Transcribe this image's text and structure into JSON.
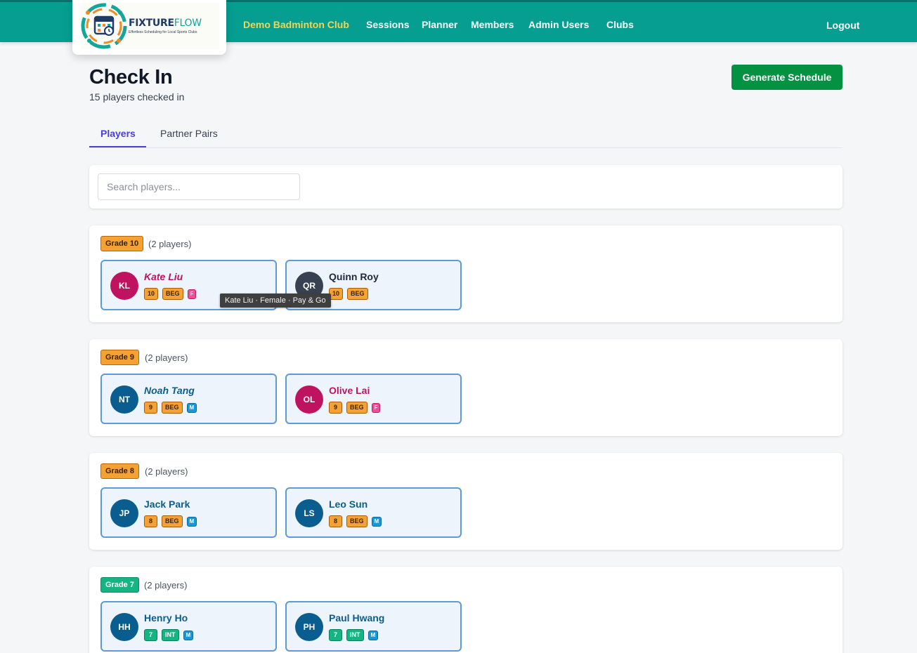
{
  "logo": {
    "name_part1": "FIXTURE",
    "name_part2": "FLOW",
    "tagline": "Effortless Scheduling for Local Sports Clubs"
  },
  "nav": {
    "club": "Demo Badminton Club",
    "sessions": "Sessions",
    "planner": "Planner",
    "members": "Members",
    "admin_users": "Admin Users",
    "clubs": "Clubs",
    "logout": "Logout"
  },
  "colors": {
    "header": "#059e91",
    "club_name": "#f6d44c",
    "primary_button": "#059142",
    "tab_active": "#4c3ed6",
    "card_border": "#5e9ad8"
  },
  "page": {
    "title": "Check In",
    "subtitle": "15 players checked in",
    "generate_button": "Generate Schedule"
  },
  "tabs": [
    {
      "label": "Players",
      "active": true
    },
    {
      "label": "Partner Pairs",
      "active": false
    }
  ],
  "search": {
    "placeholder": "Search players...",
    "value": ""
  },
  "tooltip": "Kate Liu · Female · Pay & Go",
  "grades": [
    {
      "label": "Grade 10",
      "count": "(2 players)",
      "players": [
        {
          "initials": "KL",
          "name": "Kate Liu",
          "grade": "10",
          "level": "BEG",
          "gender": "F",
          "avatar_color": "#c0135f"
        },
        {
          "initials": "QR",
          "name": "Quinn Roy",
          "grade": "10",
          "level": "BEG",
          "gender": "",
          "avatar_color": "#374151"
        }
      ]
    },
    {
      "label": "Grade 9",
      "count": "(2 players)",
      "players": [
        {
          "initials": "NT",
          "name": "Noah Tang",
          "grade": "9",
          "level": "BEG",
          "gender": "M",
          "avatar_color": "#0a5d8f"
        },
        {
          "initials": "OL",
          "name": "Olive Lai",
          "grade": "9",
          "level": "BEG",
          "gender": "F",
          "avatar_color": "#c0135f"
        }
      ]
    },
    {
      "label": "Grade 8",
      "count": "(2 players)",
      "players": [
        {
          "initials": "JP",
          "name": "Jack Park",
          "grade": "8",
          "level": "BEG",
          "gender": "M",
          "avatar_color": "#0a5d8f"
        },
        {
          "initials": "LS",
          "name": "Leo Sun",
          "grade": "8",
          "level": "BEG",
          "gender": "M",
          "avatar_color": "#0a5d8f"
        }
      ]
    },
    {
      "label": "Grade 7",
      "count": "(2 players)",
      "players": [
        {
          "initials": "HH",
          "name": "Henry Ho",
          "grade": "7",
          "level": "INT",
          "gender": "M",
          "avatar_color": "#0a5d8f"
        },
        {
          "initials": "PH",
          "name": "Paul Hwang",
          "grade": "7",
          "level": "INT",
          "gender": "M",
          "avatar_color": "#0a5d8f"
        }
      ]
    }
  ]
}
